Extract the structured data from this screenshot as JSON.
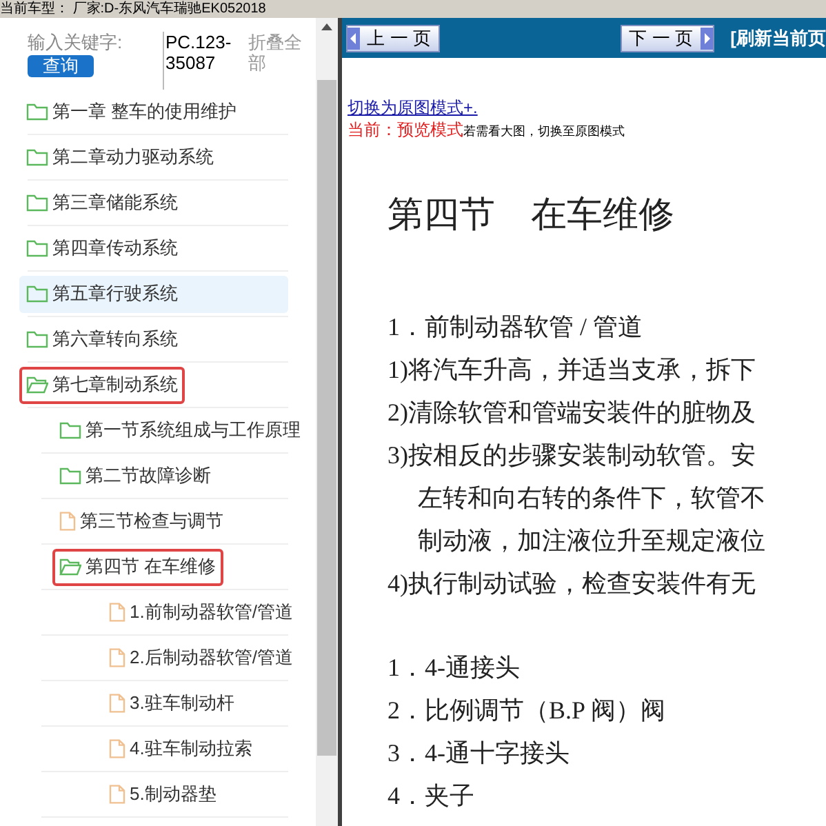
{
  "top_bar": {
    "vehicle": "当前车型： 厂家:D-东风汽车瑞驰EK052018"
  },
  "search": {
    "label": "输入关键字:",
    "button": "查询",
    "code": "PC.123-35087",
    "collapse_all": "折叠全部"
  },
  "tree": [
    {
      "kind": "folder",
      "label": "第一章 整车的使用维护",
      "expanded": false,
      "selected": false,
      "highlighted": false
    },
    {
      "kind": "folder",
      "label": "第二章动力驱动系统",
      "expanded": false,
      "selected": false,
      "highlighted": false
    },
    {
      "kind": "folder",
      "label": "第三章储能系统",
      "expanded": false,
      "selected": false,
      "highlighted": false
    },
    {
      "kind": "folder",
      "label": "第四章传动系统",
      "expanded": false,
      "selected": false,
      "highlighted": false
    },
    {
      "kind": "folder",
      "label": "第五章行驶系统",
      "expanded": false,
      "selected": false,
      "highlighted": true
    },
    {
      "kind": "folder",
      "label": "第六章转向系统",
      "expanded": false,
      "selected": false,
      "highlighted": false
    },
    {
      "kind": "folder",
      "label": "第七章制动系统",
      "expanded": true,
      "selected": true,
      "highlighted": false,
      "children": [
        {
          "kind": "folder",
          "label": "第一节系统组成与工作原理",
          "expanded": false,
          "selected": false,
          "highlighted": false
        },
        {
          "kind": "folder",
          "label": "第二节故障诊断",
          "expanded": false,
          "selected": false,
          "highlighted": false
        },
        {
          "kind": "file",
          "label": "第三节检查与调节",
          "selected": false,
          "highlighted": false
        },
        {
          "kind": "folder",
          "label": "第四节 在车维修",
          "expanded": true,
          "selected": true,
          "highlighted": false,
          "children": [
            {
              "kind": "file",
              "label": "1.前制动器软管/管道",
              "selected": false,
              "highlighted": false
            },
            {
              "kind": "file",
              "label": "2.后制动器软管/管道",
              "selected": false,
              "highlighted": false
            },
            {
              "kind": "file",
              "label": "3.驻车制动杆",
              "selected": false,
              "highlighted": false
            },
            {
              "kind": "file",
              "label": "4.驻车制动拉索",
              "selected": false,
              "highlighted": false
            },
            {
              "kind": "file",
              "label": "5.制动器垫",
              "selected": false,
              "highlighted": false
            }
          ]
        }
      ]
    }
  ],
  "toolbar": {
    "prev": "上 一 页",
    "next": "下 一 页",
    "refresh": "[刷新当前页"
  },
  "mode": {
    "switch_link": "切换为原图模式+.",
    "current": "当前：预览模式",
    "hint": "若需看大图，切换至原图模式"
  },
  "document": {
    "heading": "第四节　在车维修",
    "lines": [
      {
        "kind": "line",
        "text": "1．前制动器软管 / 管道"
      },
      {
        "kind": "line",
        "text": "1)将汽车升高，并适当支承，拆下"
      },
      {
        "kind": "line",
        "text": "2)清除软管和管端安装件的脏物及"
      },
      {
        "kind": "line",
        "text": "3)按相反的步骤安装制动软管。安"
      },
      {
        "kind": "indent",
        "text": "左转和向右转的条件下，软管不"
      },
      {
        "kind": "indent",
        "text": "制动液，加注液位升至规定液位"
      },
      {
        "kind": "line",
        "text": "4)执行制动试验，检查安装件有无"
      },
      {
        "kind": "gap"
      },
      {
        "kind": "line",
        "text": "1．4-通接头"
      },
      {
        "kind": "line",
        "text": "2．比例调节（B.P 阀）阀"
      },
      {
        "kind": "line",
        "text": "3．4-通十字接头"
      },
      {
        "kind": "line",
        "text": "4．夹子"
      }
    ]
  }
}
